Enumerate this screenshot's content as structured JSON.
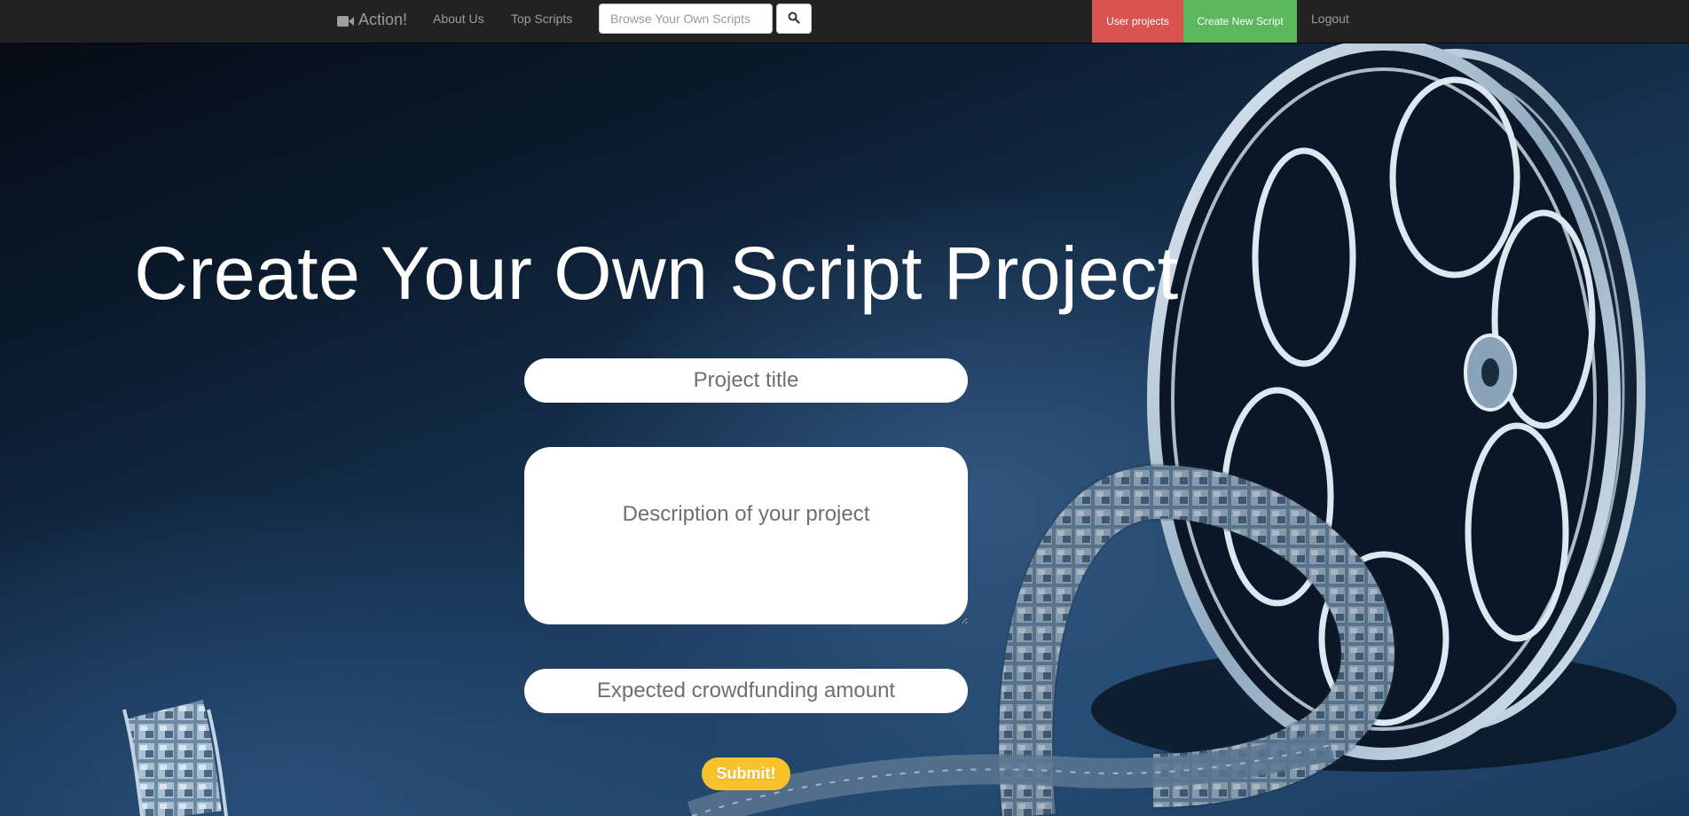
{
  "navbar": {
    "brand_label": "Action!",
    "brand_icon": "video-camera-icon",
    "links": {
      "about": "About Us",
      "top_scripts": "Top Scripts",
      "logout": "Logout"
    },
    "search": {
      "placeholder": "Browse Your Own Scripts",
      "value": "",
      "button_icon": "search-icon"
    },
    "buttons": {
      "user_projects": "User projects",
      "create_new_script": "Create New Script"
    },
    "colors": {
      "bar": "#222222",
      "user_projects": "#d9534f",
      "create_new_script": "#5cb85c"
    }
  },
  "main": {
    "title": "Create Your Own Script Project",
    "form": {
      "project_title_placeholder": "Project title",
      "description_placeholder": "Description of your project",
      "amount_placeholder": "Expected crowdfunding amount",
      "submit_label": "Submit!",
      "submit_color": "#f7c22b"
    },
    "background_image": "film-reel-image"
  }
}
